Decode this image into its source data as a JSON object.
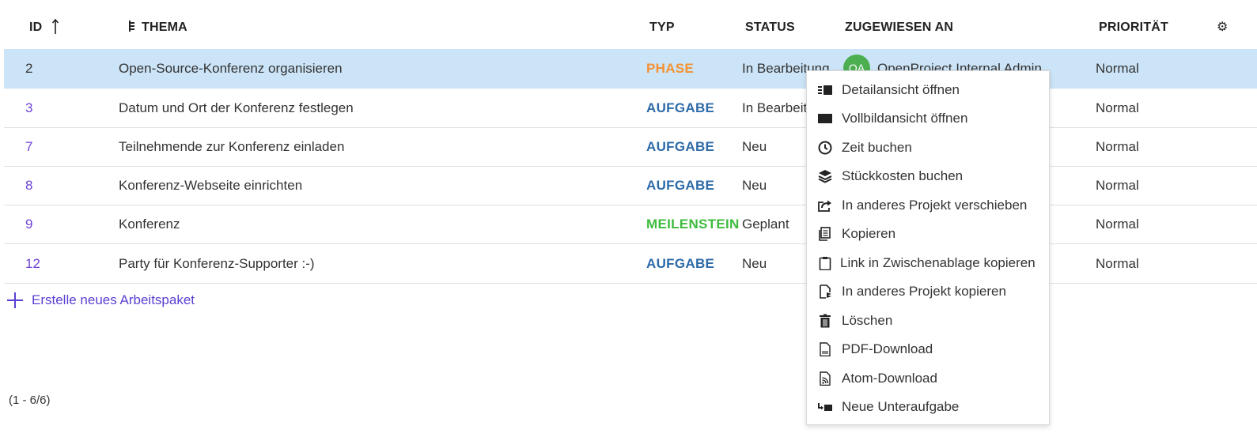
{
  "table": {
    "headers": {
      "id": "ID",
      "subject": "THEMA",
      "type": "TYP",
      "status": "STATUS",
      "assignee": "ZUGEWIESEN AN",
      "priority": "PRIORITÄT"
    },
    "sort": {
      "column": "ID",
      "direction": "ascending"
    },
    "rows": [
      {
        "id": "2",
        "subject": "Open-Source-Konferenz organisieren",
        "type": "PHASE",
        "type_color": "#f39233",
        "status": "In Bearbeitung",
        "assignee_initials": "OA",
        "assignee": "OpenProject Internal Admin",
        "priority": "Normal",
        "selected": true
      },
      {
        "id": "3",
        "subject": "Datum und Ort der Konferenz festlegen",
        "type": "AUFGABE",
        "type_color": "#2d6aa8",
        "status": "In Bearbeitung",
        "priority": "Normal"
      },
      {
        "id": "7",
        "subject": "Teilnehmende zur Konferenz einladen",
        "type": "AUFGABE",
        "type_color": "#2d6aa8",
        "status": "Neu",
        "priority": "Normal"
      },
      {
        "id": "8",
        "subject": "Konferenz-Webseite einrichten",
        "type": "AUFGABE",
        "type_color": "#2d6aa8",
        "status": "Neu",
        "priority": "Normal"
      },
      {
        "id": "9",
        "subject": "Konferenz",
        "type": "MEILENSTEIN",
        "type_color": "#3dbb3d",
        "status": "Geplant",
        "priority": "Normal"
      },
      {
        "id": "12",
        "subject": "Party für Konferenz-Supporter :-)",
        "type": "AUFGABE",
        "type_color": "#2d6aa8",
        "status": "Neu",
        "priority": "Normal"
      }
    ]
  },
  "create_label": "Erstelle neues Arbeitspaket",
  "pagination": "(1 - 6/6)",
  "context_menu": {
    "items": [
      {
        "label": "Detailansicht öffnen",
        "icon": "detail-view-icon"
      },
      {
        "label": "Vollbildansicht öffnen",
        "icon": "fullscreen-icon"
      },
      {
        "label": "Zeit buchen",
        "icon": "clock-icon"
      },
      {
        "label": "Stückkosten buchen",
        "icon": "layers-icon"
      },
      {
        "label": "In anderes Projekt verschieben",
        "icon": "move-icon"
      },
      {
        "label": "Kopieren",
        "icon": "copy-icon"
      },
      {
        "label": "Link in Zwischenablage kopieren",
        "icon": "clipboard-icon"
      },
      {
        "label": "In anderes Projekt kopieren",
        "icon": "copy-to-project-icon"
      },
      {
        "label": "Löschen",
        "icon": "trash-icon"
      },
      {
        "label": "PDF-Download",
        "icon": "pdf-icon"
      },
      {
        "label": "Atom-Download",
        "icon": "atom-feed-icon"
      },
      {
        "label": "Neue Unteraufgabe",
        "icon": "subtask-icon"
      }
    ]
  },
  "colors": {
    "accent": "#5b3fd1",
    "selected_row": "#cce4f7",
    "avatar": "#4caf50"
  }
}
